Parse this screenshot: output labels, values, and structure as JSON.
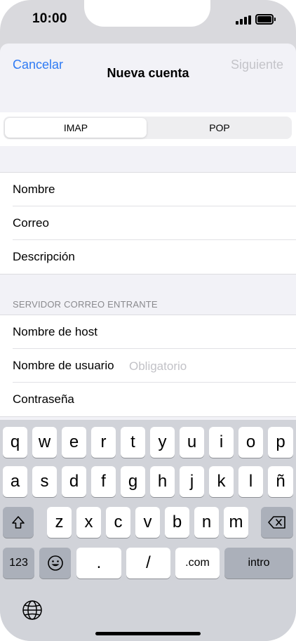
{
  "status_bar": {
    "time": "10:00"
  },
  "nav": {
    "cancel": "Cancelar",
    "title": "Nueva cuenta",
    "next": "Siguiente"
  },
  "segmented": {
    "options": [
      "IMAP",
      "POP"
    ],
    "selected": "IMAP"
  },
  "account_fields": [
    {
      "label": "Nombre"
    },
    {
      "label": "Correo"
    },
    {
      "label": "Descripción"
    }
  ],
  "incoming_server": {
    "header": "SERVIDOR CORREO ENTRANTE",
    "fields": [
      {
        "label": "Nombre de host",
        "placeholder": ""
      },
      {
        "label": "Nombre de usuario",
        "placeholder": "Obligatorio"
      },
      {
        "label": "Contraseña",
        "placeholder": ""
      }
    ]
  },
  "keyboard": {
    "row1": [
      "q",
      "w",
      "e",
      "r",
      "t",
      "y",
      "u",
      "i",
      "o",
      "p"
    ],
    "row2": [
      "a",
      "s",
      "d",
      "f",
      "g",
      "h",
      "j",
      "k",
      "l",
      "ñ"
    ],
    "row3": [
      "z",
      "x",
      "c",
      "v",
      "b",
      "n",
      "m"
    ],
    "numbers_key": "123",
    "period_key": ".",
    "slash_key": "/",
    "dotcom_key": ".com",
    "return_key": "intro",
    "icons": [
      "shift-icon",
      "backspace-icon",
      "emoji-icon",
      "globe-icon"
    ]
  },
  "colors": {
    "accent": "#2f7bf4",
    "disabled": "#c4c4c9",
    "placeholder": "#c2c2c7"
  }
}
